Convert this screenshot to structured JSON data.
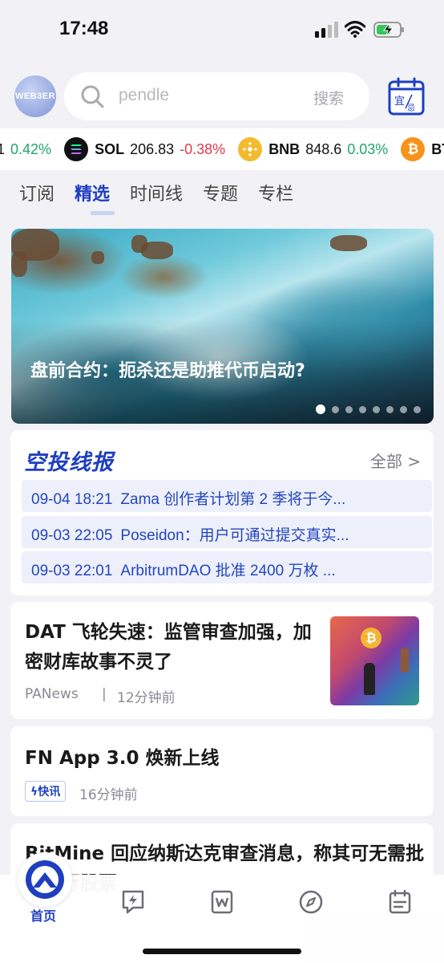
{
  "status_bar": {
    "time": "17:48"
  },
  "header": {
    "avatar_text": "WEB3ER",
    "search_placeholder": "pendle",
    "search_button": "搜索",
    "calendar_icon": "yi-ji-calendar-icon",
    "calendar_text": "宜忌"
  },
  "ticker": [
    {
      "symbol": "",
      "price": "1",
      "change": "0.42%",
      "direction": "up",
      "icon": "",
      "color": ""
    },
    {
      "symbol": "SOL",
      "price": "206.83",
      "change": "-0.38%",
      "direction": "down",
      "icon": "sol-icon",
      "color": "#111111"
    },
    {
      "symbol": "BNB",
      "price": "848.6",
      "change": "0.03%",
      "direction": "up",
      "icon": "bnb-icon",
      "color": "#f3ba2f"
    },
    {
      "symbol": "BT",
      "price": "",
      "change": "",
      "direction": "",
      "icon": "btc-icon",
      "color": "#f7931a"
    }
  ],
  "tabs": [
    {
      "label": "订阅",
      "active": false
    },
    {
      "label": "精选",
      "active": true
    },
    {
      "label": "时间线",
      "active": false
    },
    {
      "label": "专题",
      "active": false
    },
    {
      "label": "专栏",
      "active": false
    }
  ],
  "hero": {
    "title": "盘前合约：扼杀还是助推代币启动?",
    "slides": 8,
    "current_slide": 1
  },
  "airdrop": {
    "title": "空投线报",
    "all_label": "全部 >",
    "items": [
      {
        "time": "09-04 18:21",
        "text": "Zama 创作者计划第 2 季将于今..."
      },
      {
        "time": "09-03 22:05",
        "text": "Poseidon：用户可通过提交真实..."
      },
      {
        "time": "09-03 22:01",
        "text": "ArbitrumDAO 批准 2400 万枚 ..."
      }
    ]
  },
  "news": [
    {
      "title": "DAT 飞轮失速：监管审查加强，加密财库故事不灵了",
      "source": "PANews",
      "separator": "|",
      "time": "12分钟前"
    },
    {
      "title": "FN App 3.0 焕新上线",
      "badge": "快讯",
      "time": "16分钟前"
    },
    {
      "title": "BitMine 回应纳斯达克审查消息，称其可无需批准发行股票"
    }
  ],
  "bottom_nav": {
    "home_label": "首页",
    "items": [
      "home-icon",
      "flash-icon",
      "article-icon",
      "compass-icon",
      "calendar-icon"
    ]
  },
  "colors": {
    "accent": "#1f3fbf",
    "up": "#1fa86a",
    "down": "#e03a4a",
    "background": "#f2f2f6"
  }
}
